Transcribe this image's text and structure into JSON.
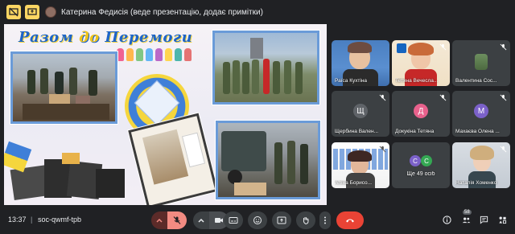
{
  "topbar": {
    "presenter_text": "Катерина Федисія (веде презентацію, додає примітки)",
    "icons": [
      "screen-off-icon",
      "screen-share-icon"
    ]
  },
  "slide": {
    "title_part1": "Разом ",
    "title_accent": "до",
    "title_part2": " Перемоги"
  },
  "participants": [
    {
      "name": "Раїса Кухтіна",
      "muted": false,
      "kind": "video"
    },
    {
      "name": "Тетяна Вечесла...",
      "muted": true,
      "kind": "video"
    },
    {
      "name": "Валентина Сос...",
      "muted": true,
      "kind": "photo"
    },
    {
      "name": "Щербина Вален...",
      "muted": true,
      "kind": "letter",
      "letter": "Щ",
      "color": "#5f6368"
    },
    {
      "name": "Докукіна Тетяна",
      "muted": true,
      "kind": "letter",
      "letter": "Д",
      "color": "#e8618c"
    },
    {
      "name": "Махаєва Олена ...",
      "muted": true,
      "kind": "letter",
      "letter": "М",
      "color": "#7b61c9"
    },
    {
      "name": "Аліна Борисо...",
      "muted": true,
      "kind": "photo"
    },
    {
      "name": "Ще 49 осіб",
      "muted": false,
      "kind": "group",
      "letters": [
        "С",
        "С"
      ]
    },
    {
      "name": "Наталія Хоменко",
      "muted": true,
      "kind": "video"
    }
  ],
  "bottombar": {
    "time": "13:37",
    "separator": "|",
    "meeting_code": "soc-qwmf-tpb",
    "participants_count": "58"
  },
  "colors": {
    "background": "#202124",
    "tile": "#3c4043",
    "accent_yellow": "#fdd663",
    "end_call": "#ea4335",
    "mic_off": "#f28b82"
  }
}
